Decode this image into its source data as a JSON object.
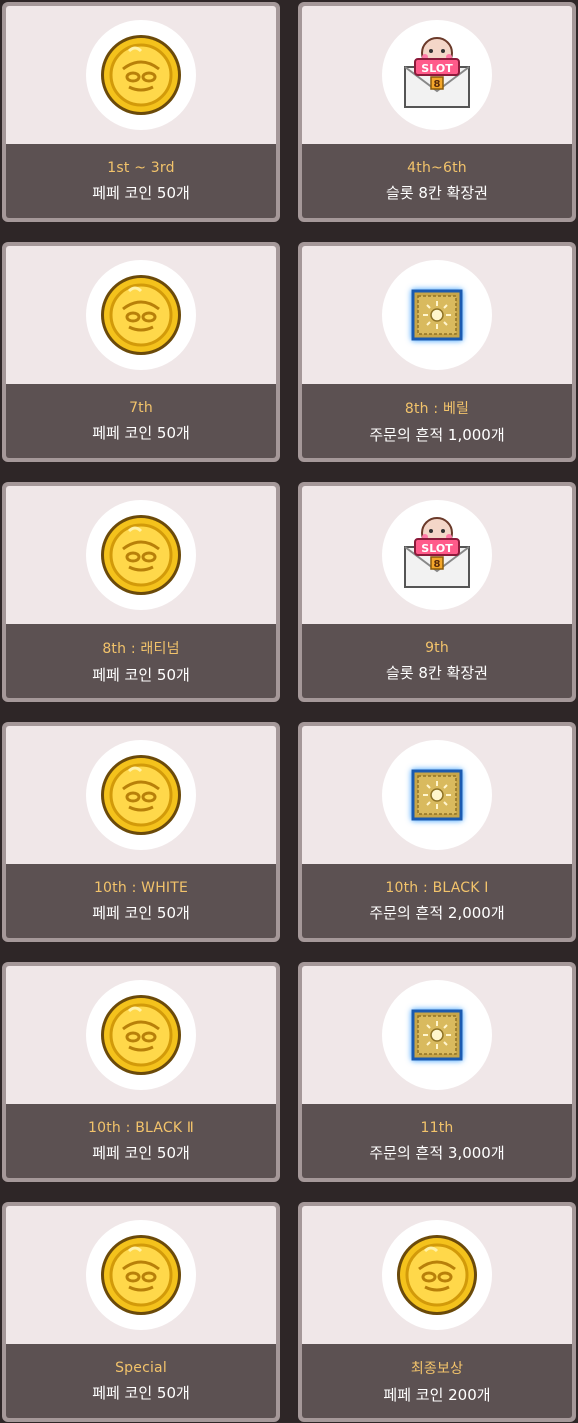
{
  "rewards": [
    {
      "rank": "1st ~ 3rd",
      "reward": "페페 코인 50개",
      "icon": "coin-icon"
    },
    {
      "rank": "4th~6th",
      "reward": "슬롯 8칸 확장권",
      "icon": "slot-ticket-icon"
    },
    {
      "rank": "7th",
      "reward": "페페 코인 50개",
      "icon": "coin-icon"
    },
    {
      "rank": "8th : 베릴",
      "reward": "주문의 흔적 1,000개",
      "icon": "scroll-icon"
    },
    {
      "rank": "8th : 래티넘",
      "reward": "페페 코인 50개",
      "icon": "coin-icon"
    },
    {
      "rank": "9th",
      "reward": "슬롯 8칸 확장권",
      "icon": "slot-ticket-icon"
    },
    {
      "rank": "10th : WHITE",
      "reward": "페페 코인 50개",
      "icon": "coin-icon"
    },
    {
      "rank": "10th : BLACK Ⅰ",
      "reward": "주문의 흔적 2,000개",
      "icon": "scroll-icon"
    },
    {
      "rank": "10th : BLACK Ⅱ",
      "reward": "페페 코인 50개",
      "icon": "coin-icon"
    },
    {
      "rank": "11th",
      "reward": "주문의 흔적 3,000개",
      "icon": "scroll-icon"
    },
    {
      "rank": "Special",
      "reward": "페페 코인 50개",
      "icon": "coin-icon"
    },
    {
      "rank": "최종보상",
      "reward": "페페 코인 200개",
      "icon": "coin-icon"
    }
  ],
  "slot_icon_text": {
    "slot": "SLOT",
    "num": "8"
  },
  "colors": {
    "background": "#2e2627",
    "card_border": "#a59899",
    "card_top": "#f0e7e8",
    "card_bottom": "#5c5152",
    "rank_text": "#f2c36b",
    "reward_text": "#ffffff"
  }
}
